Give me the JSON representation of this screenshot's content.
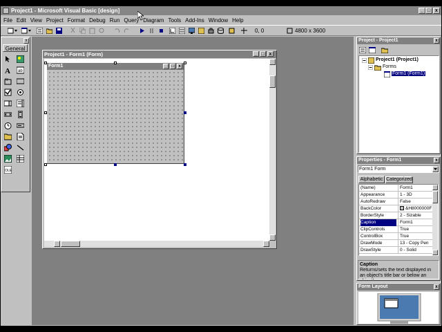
{
  "title": "Project1 - Microsoft Visual Basic [design]",
  "menu": [
    "File",
    "Edit",
    "View",
    "Project",
    "Format",
    "Debug",
    "Run",
    "Query",
    "Diagram",
    "Tools",
    "Add-Ins",
    "Window",
    "Help"
  ],
  "toolbar": {
    "position": "0, 0",
    "size": "4800 x 3600"
  },
  "toolbox": {
    "tab": "General"
  },
  "designer": {
    "title": "Project1 - Form1 (Form)",
    "form_caption": "Form1"
  },
  "project": {
    "title": "Project - Project1",
    "root": "Project1 (Project1)",
    "folder": "Forms",
    "item": "Form1 (Form1)"
  },
  "properties": {
    "title": "Properties - Form1",
    "object": "Form1  Form",
    "tabs": [
      "Alphabetic",
      "Categorized"
    ],
    "rows": [
      {
        "name": "(Name)",
        "value": "Form1"
      },
      {
        "name": "Appearance",
        "value": "1 - 3D"
      },
      {
        "name": "AutoRedraw",
        "value": "False"
      },
      {
        "name": "BackColor",
        "value": "&H8000000F"
      },
      {
        "name": "BorderStyle",
        "value": "2 - Sizable"
      },
      {
        "name": "Caption",
        "value": "Form1"
      },
      {
        "name": "ClipControls",
        "value": "True"
      },
      {
        "name": "ControlBox",
        "value": "True"
      },
      {
        "name": "DrawMode",
        "value": "13 - Copy Pen"
      },
      {
        "name": "DrawStyle",
        "value": "0 - Solid"
      }
    ],
    "desc_title": "Caption",
    "desc_text": "Returns/sets the text displayed in an object's title bar or below an object's"
  },
  "layout": {
    "title": "Form Layout"
  },
  "colors": {
    "title_active": "#000080",
    "title_inactive": "#808080",
    "face": "#c0c0c0",
    "mdi": "#808080",
    "selection": "#000080",
    "screen": "#4a7ab0"
  },
  "icons": [
    "pointer-icon",
    "picturebox-icon",
    "label-icon",
    "textbox-icon",
    "frame-icon",
    "commandbutton-icon",
    "checkbox-icon",
    "optionbutton-icon",
    "combobox-icon",
    "listbox-icon",
    "hscrollbar-icon",
    "vscrollbar-icon",
    "timer-icon",
    "drivelistbox-icon",
    "dirlistbox-icon",
    "filelistbox-icon",
    "shape-icon",
    "line-icon",
    "image-icon",
    "data-icon",
    "ole-icon"
  ]
}
